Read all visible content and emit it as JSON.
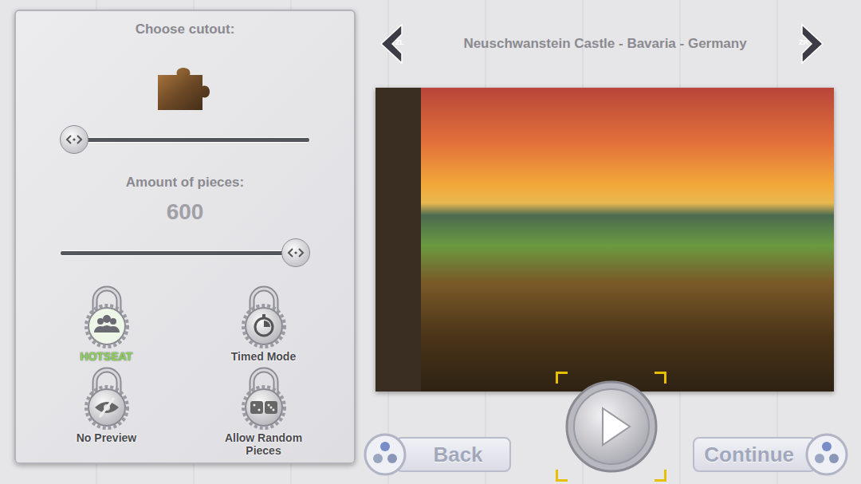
{
  "cutout": {
    "label": "Choose cutout:",
    "level": 0.0
  },
  "pieces": {
    "label": "Amount of pieces:",
    "value": "600",
    "level": 1.0
  },
  "toggles": [
    {
      "label": "HOTSEAT",
      "kind": "players",
      "on": true
    },
    {
      "label": "Timed Mode",
      "kind": "timer",
      "on": false
    },
    {
      "label": "No Preview",
      "kind": "preview",
      "on": false
    },
    {
      "label": "Allow Random Pieces",
      "kind": "random",
      "on": false
    }
  ],
  "gallery": {
    "prev_key": "ZL",
    "next_key": "ZR",
    "title": "Neuschwanstein Castle - Bavaria - Germany"
  },
  "buttons": [
    {
      "label": "Back"
    },
    {
      "label": "Continue"
    }
  ]
}
